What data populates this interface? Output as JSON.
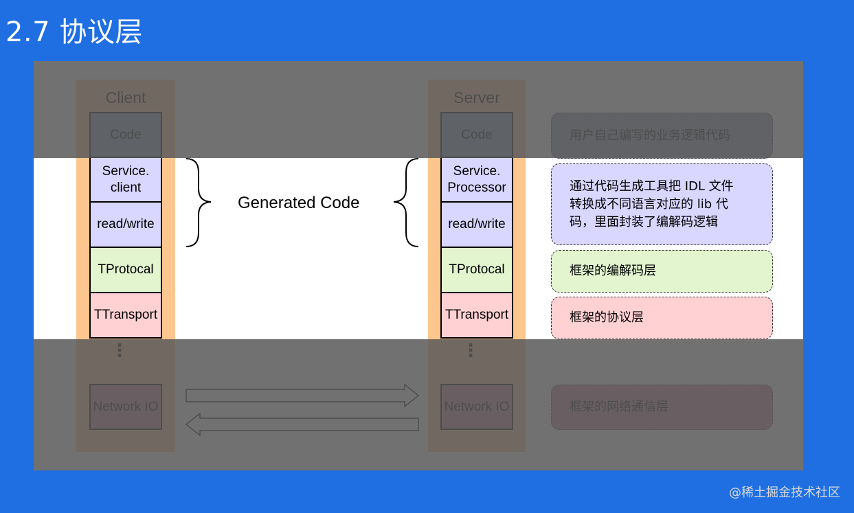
{
  "header": {
    "title": "2.7 协议层"
  },
  "client": {
    "title": "Client",
    "layers": [
      "Code",
      "Service.\nclient",
      "read/write",
      "TProtocal",
      "TTransport"
    ],
    "dots": "⋮",
    "network": "Network IO"
  },
  "server": {
    "title": "Server",
    "layers": [
      "Code",
      "Service.\nProcessor",
      "read/write",
      "TProtocal",
      "TTransport"
    ],
    "dots": "⋮",
    "network": "Network IO"
  },
  "generated_label": "Generated Code",
  "notes": [
    "用户自己编写的业务逻辑代码",
    "通过代码生成工具把 IDL 文件\n转换成不同语言对应的 lib 代\n码，里面封装了编解码逻辑",
    "框架的编解码层",
    "框架的协议层",
    "框架的网络通信层"
  ],
  "watermark": "@稀土掘金技术社区",
  "colors": {
    "background": "#1f6fe3",
    "stack": "#fdc68f",
    "code": "#7f93b0",
    "generated": "#d9d6ff",
    "protocol": "#e2f5cf",
    "transport": "#ffd1d3",
    "network": "#c77d9e"
  }
}
